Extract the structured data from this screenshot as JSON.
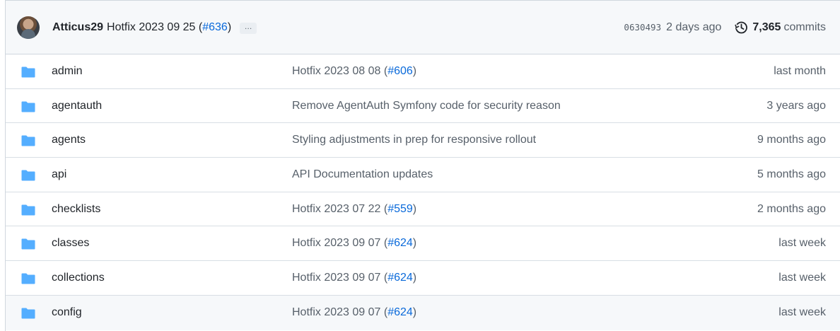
{
  "header": {
    "author": "Atticus29",
    "message": "Hotfix 2023 09 25 (",
    "pr_link": "#636",
    "message_end": ")",
    "ellipsis": "…",
    "sha": "0630493",
    "ago": "2 days ago",
    "commit_count": "7,365",
    "commits_label": "commits"
  },
  "rows": [
    {
      "name": "admin",
      "msg": "Hotfix 2023 08 08 (",
      "link": "#606",
      "msg_end": ")",
      "when": "last month"
    },
    {
      "name": "agentauth",
      "msg": "Remove AgentAuth Symfony code for security reason",
      "link": "",
      "msg_end": "",
      "when": "3 years ago"
    },
    {
      "name": "agents",
      "msg": "Styling adjustments in prep for responsive rollout",
      "link": "",
      "msg_end": "",
      "when": "9 months ago"
    },
    {
      "name": "api",
      "msg": "API Documentation updates",
      "link": "",
      "msg_end": "",
      "when": "5 months ago"
    },
    {
      "name": "checklists",
      "msg": "Hotfix 2023 07 22 (",
      "link": "#559",
      "msg_end": ")",
      "when": "2 months ago"
    },
    {
      "name": "classes",
      "msg": "Hotfix 2023 09 07 (",
      "link": "#624",
      "msg_end": ")",
      "when": "last week"
    },
    {
      "name": "collections",
      "msg": "Hotfix 2023 09 07 (",
      "link": "#624",
      "msg_end": ")",
      "when": "last week"
    },
    {
      "name": "config",
      "msg": "Hotfix 2023 09 07 (",
      "link": "#624",
      "msg_end": ")",
      "when": "last week"
    }
  ],
  "colors": {
    "folder": "#54aeff",
    "link": "#0969da",
    "muted": "#57606a",
    "header_bg": "#f6f8fa"
  },
  "icons": {
    "avatar": "author-avatar",
    "history": "history-icon",
    "folder": "folder-icon"
  }
}
